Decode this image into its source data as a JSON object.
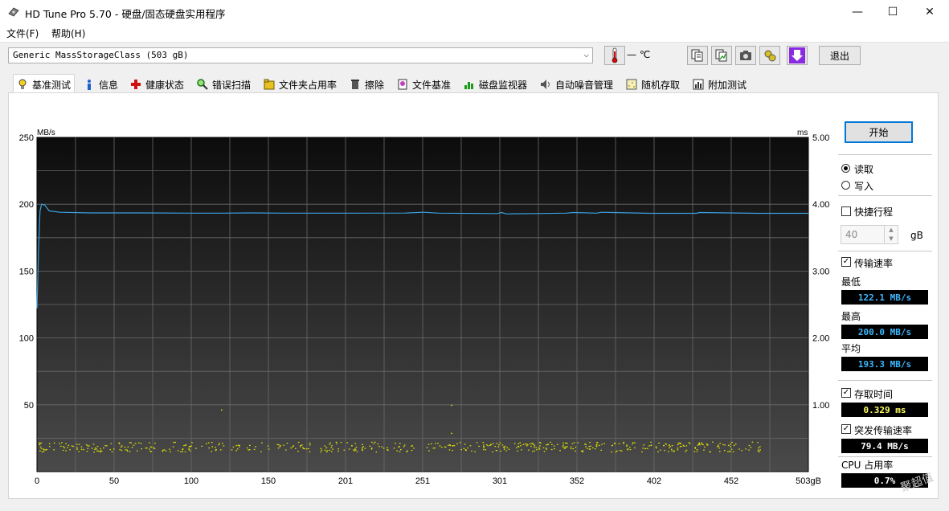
{
  "window": {
    "title": "HD Tune Pro 5.70 - 硬盘/固态硬盘实用程序",
    "minimize": "—",
    "maximize": "☐",
    "close": "✕"
  },
  "menu": {
    "file": "文件(F)",
    "help": "帮助(H)"
  },
  "toolbar": {
    "drive": "Generic MassStorageClass (503 gB)",
    "temperature": "— ℃",
    "exit_label": "退出",
    "buttons": [
      "copy-info-icon",
      "copy-chart-icon",
      "screenshot-camera-icon",
      "options-icon",
      "save-download-icon"
    ]
  },
  "tabs": [
    {
      "label": "基准测试",
      "icon": "benchmark-icon",
      "active": true
    },
    {
      "label": "信息",
      "icon": "info-icon"
    },
    {
      "label": "健康状态",
      "icon": "health-cross-icon"
    },
    {
      "label": "错误扫描",
      "icon": "magnifier-icon"
    },
    {
      "label": "文件夹占用率",
      "icon": "folder-icon"
    },
    {
      "label": "擦除",
      "icon": "trash-icon"
    },
    {
      "label": "文件基准",
      "icon": "file-benchmark-icon"
    },
    {
      "label": "磁盘监视器",
      "icon": "disk-monitor-icon"
    },
    {
      "label": "自动噪音管理",
      "icon": "speaker-icon"
    },
    {
      "label": "随机存取",
      "icon": "random-access-icon"
    },
    {
      "label": "附加测试",
      "icon": "extra-tests-icon"
    }
  ],
  "controls": {
    "start_label": "开始",
    "read_label": "读取",
    "write_label": "写入",
    "short_stroke_label": "快捷行程",
    "short_stroke_value": "40",
    "short_stroke_unit": "gB",
    "transfer_rate_label": "传输速率",
    "min_label": "最低",
    "min_value": "122.1 MB/s",
    "max_label": "最高",
    "max_value": "200.0 MB/s",
    "avg_label": "平均",
    "avg_value": "193.3 MB/s",
    "access_time_label": "存取时间",
    "access_time_value": "0.329 ms",
    "burst_rate_label": "突发传输速率",
    "burst_rate_value": "79.4 MB/s",
    "cpu_label": "CPU 占用率",
    "cpu_value": "0.7%"
  },
  "watermark": "聚超值",
  "chart_data": {
    "type": "line",
    "left_unit": "MB/s",
    "right_unit": "ms",
    "ylim": [
      0,
      250
    ],
    "y2lim": [
      0,
      5
    ],
    "left_ticks": [
      "250",
      "200",
      "150",
      "100",
      "50"
    ],
    "right_ticks": [
      "5.00",
      "4.00",
      "3.00",
      "2.00",
      "1.00"
    ],
    "x_ticks": [
      "0",
      "50",
      "100",
      "150",
      "201",
      "251",
      "301",
      "352",
      "402",
      "452",
      "503gB"
    ],
    "xlim": [
      0,
      503
    ],
    "series": [
      {
        "name": "传输速率",
        "color": "#3aa0e0",
        "x": [
          0,
          1,
          2,
          3,
          5,
          8,
          15,
          35,
          70,
          100,
          120,
          140,
          160,
          200,
          240,
          252,
          262,
          300,
          303,
          306,
          330,
          345,
          350,
          365,
          368,
          400,
          430,
          432,
          470,
          503
        ],
        "y": [
          122.1,
          165,
          195,
          200,
          199.5,
          195,
          194,
          193.5,
          193.5,
          193.3,
          193.3,
          193.5,
          193.3,
          193.3,
          193.4,
          194,
          193.3,
          193,
          193.8,
          192.8,
          193.1,
          193.3,
          193.8,
          193.3,
          194,
          193.2,
          193.2,
          193.8,
          193.2,
          193.2
        ]
      },
      {
        "name": "存取时间",
        "color": "#e8e800",
        "type": "scatter",
        "y_range_ms": [
          0.3,
          0.45
        ],
        "outliers_ms": [
          [
            120,
            0.93
          ],
          [
            270,
            0.58
          ],
          [
            270,
            1.0
          ]
        ]
      }
    ]
  }
}
